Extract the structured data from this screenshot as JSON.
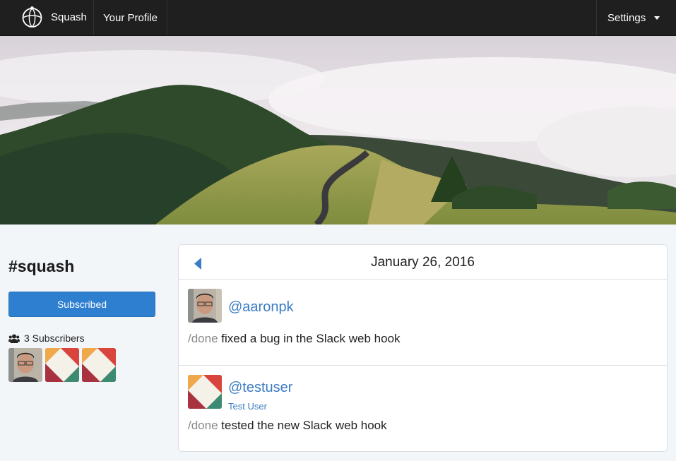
{
  "nav": {
    "brand": "Squash",
    "profile": "Your Profile",
    "settings": "Settings"
  },
  "channel": {
    "title": "#squash",
    "subscribe_label": "Subscribed",
    "subscriber_count_label": "3 Subscribers",
    "subscribers": [
      "aaronpk-avatar",
      "testuser-avatar",
      "testuser-avatar"
    ]
  },
  "card": {
    "date": "January 26, 2016",
    "posts": [
      {
        "username": "@aaronpk",
        "fullname": "",
        "command": "/done",
        "text": " fixed a bug in the Slack web hook"
      },
      {
        "username": "@testuser",
        "fullname": "Test User",
        "command": "/done",
        "text": " tested the new Slack web hook"
      }
    ]
  },
  "colors": {
    "navbar": "#1f1f1f",
    "accent_button": "#2f7fd0",
    "link": "#3b7cc4",
    "page_bg": "#f3f6f9"
  }
}
